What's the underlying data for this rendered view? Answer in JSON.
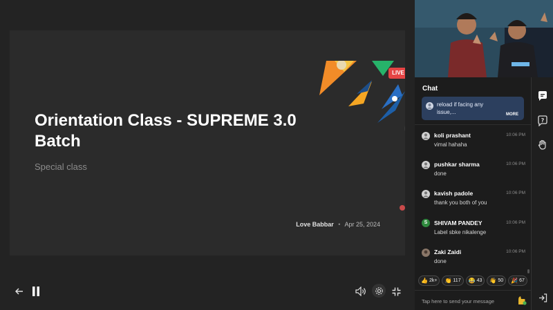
{
  "slide": {
    "title": "Orientation Class - SUPREME 3.0 Batch",
    "subtitle": "Special class",
    "author": "Love Babbar",
    "separator": "•",
    "date": "Apr 25, 2024",
    "live_label": "LIVE"
  },
  "chat": {
    "title": "Chat",
    "pinned_text": "reload if facing any issue,...",
    "pinned_more": "MORE",
    "messages": [
      {
        "name": "koli prashant",
        "time": "10:06 PM",
        "text": "vimal hahaha",
        "avatar": "user-icon"
      },
      {
        "name": "pushkar sharma",
        "time": "10:06 PM",
        "text": "done",
        "avatar": "user-icon"
      },
      {
        "name": "kavish padole",
        "time": "10:06 PM",
        "text": "thank you both of you",
        "avatar": "user-icon"
      },
      {
        "name": "SHIVAM PANDEY",
        "time": "10:06 PM",
        "text": "Label sbke nikalenge",
        "avatar": "letter-avatar",
        "initial": "S",
        "avatar_color": "#2f8a3e"
      },
      {
        "name": "Zaki Zaidi",
        "time": "10:06 PM",
        "text": "done",
        "avatar": "photo-avatar"
      }
    ],
    "reactions": [
      {
        "emoji": "👍",
        "count": "2k+"
      },
      {
        "emoji": "👏",
        "count": "117"
      },
      {
        "emoji": "😂",
        "count": "43"
      },
      {
        "emoji": "👋",
        "count": "50"
      },
      {
        "emoji": "🎉",
        "count": "67"
      }
    ],
    "input_placeholder": "Tap here to send your message"
  },
  "colors": {
    "live": "#e64545",
    "pinned_bg": "#2c3f5e",
    "panel_bg": "#1c1c1c",
    "stage_bg": "#232323"
  }
}
